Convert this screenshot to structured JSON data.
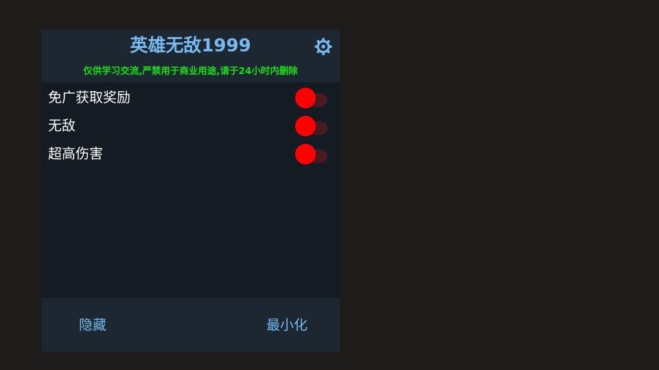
{
  "header": {
    "title": "英雄无敌1999",
    "subtitle": "仅供学习交流,严禁用于商业用途,请于24小时内删除",
    "settings_icon": "gear-icon"
  },
  "options": [
    {
      "label": "免广获取奖励",
      "enabled": false
    },
    {
      "label": "无敌",
      "enabled": false
    },
    {
      "label": "超高伤害",
      "enabled": false
    }
  ],
  "footer": {
    "hide_label": "隐藏",
    "minimize_label": "最小化"
  },
  "colors": {
    "accent": "#78baf0",
    "notice": "#19e019",
    "switch_thumb": "#ff0000",
    "switch_track": "#4a1a21",
    "panel_bg": "#151b23",
    "bar_bg": "#1d2731"
  }
}
